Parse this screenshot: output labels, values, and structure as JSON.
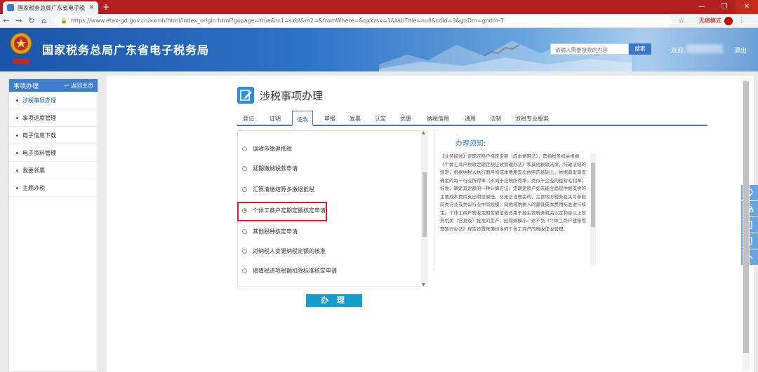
{
  "browser": {
    "tab_title": "国家税务总局广东省电子税务局",
    "url_text": "https://www.etax-gd.gov.cn/xxmh/html/index_origin.html?gopage=true&m1=sxbl&m2=&fromWhere=&qxkzsx=1&tabTitle=null&cdId=3&gnDm=gndm-3",
    "incognito_label": "无痕模式"
  },
  "header": {
    "site_title": "国家税务总局广东省电子税务局",
    "search_placeholder": "请输入需要搜索的内容",
    "search_button": "搜索",
    "welcome_label": "欢迎,",
    "logout_label": "退出"
  },
  "sidebar": {
    "title": "事项办理",
    "back_home": "返回主页",
    "items": [
      {
        "label": "涉税事项办理"
      },
      {
        "label": "事项进度管理"
      },
      {
        "label": "电子信息下载"
      },
      {
        "label": "电子资料管理"
      },
      {
        "label": "我要领票"
      },
      {
        "label": "主题办税"
      }
    ]
  },
  "main": {
    "page_title": "涉税事项办理",
    "tabs": [
      "登记",
      "证明",
      "征收",
      "申报",
      "发票",
      "认定",
      "优惠",
      "纳税信用",
      "通用",
      "法制",
      "涉税专业服务"
    ],
    "active_tab": "征收",
    "options": [
      {
        "label": "误收多缴退抵税"
      },
      {
        "label": "延期缴纳税款申请"
      },
      {
        "label": "汇算清缴结算多缴退抵税"
      },
      {
        "label": "个体工商户定期定额核定申请"
      },
      {
        "label": "其他税种核定申请"
      },
      {
        "label": "对纳税人变更纳税定额的核准"
      },
      {
        "label": "增值税进项税额扣除标准核定申请"
      }
    ],
    "selected_option": "个体工商户定期定额核定申请",
    "handle_button": "办 理",
    "notice": {
      "title": "办理须知:",
      "body": "【业务描述】定期定额户核定定额（成本费用法），是指税务机关根据《个体工商户税收定期定额征收管理办法》和其他税收法律、行政法规的规定，根据纳税人执行期月均成本费用支出依照的基础上，依据典型调查确定的每一行业所得率（不同于应税所得率，类似于企业的经营毛利率）标准，确定其定额的一种计算方法。定期定额户如未能全面提供据提供的主要成本费用支出明显偏低，又无正当理由的，主管地方税务机关可参照同类行业或类似行业中同规模、同地域纳税人的最低成本费用标准进行核定。个体工商户税收定期定额征收适用于经主管税务机关认定和县以上税务机关（含县级）批准的生产、经营规模小、达不到《个体工商户建账管理暂行办法》规定设置账簿标准的个体工商户的税收征收管理。"
    }
  }
}
